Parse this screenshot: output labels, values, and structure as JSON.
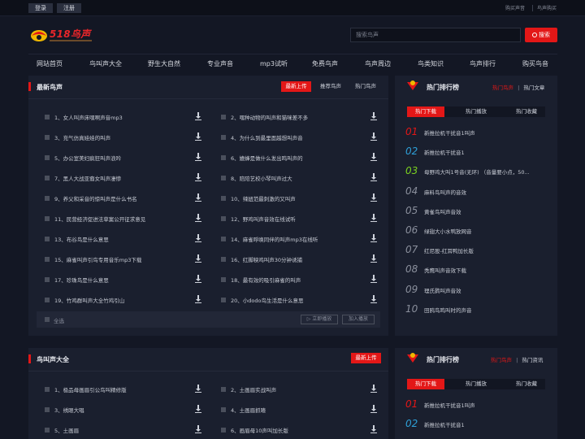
{
  "topbar": {
    "login": "登录",
    "register": "注册",
    "buy_sound": "购买声音",
    "buy_bird": "鸟声购买"
  },
  "logo": {
    "text": "518鸟声"
  },
  "search": {
    "placeholder": "搜索鸟声",
    "button": "搜索"
  },
  "nav": [
    "网站首页",
    "鸟叫声大全",
    "野生大自然",
    "专业声音",
    "mp3试听",
    "免费鸟声",
    "鸟声周边",
    "鸟类知识",
    "鸟声排行",
    "购买鸟音"
  ],
  "latest": {
    "title": "最新鸟声",
    "tabs": [
      "最新上传",
      "推荐鸟声",
      "热门鸟声"
    ],
    "left": [
      "1、女人叫声床嘿啊声音mp3",
      "3、充气仿真娃娃的叫声",
      "5、办公室美妇疯狂叫声浪吟",
      "7、黑人大战亚裔女叫声凄惨",
      "9、养父和采音的惊叫声是什么书名",
      "11、民营经济促进法草案公开征求意见",
      "13、布谷鸟是什么意思",
      "15、麻雀叫声引鸟专用音乐mp3下载",
      "17、珍珠鸟是什么意思",
      "19、竹鸡群叫声大全竹鸡引山"
    ],
    "right": [
      "2、嘿种动物的叫声和猫咪差不多",
      "4、为什么到最里面越想叫声音",
      "6、嬉蜂是做什么发出鸣叫声的",
      "8、陪陪艺校小琴叫声过大",
      "10、辣妞范最刺激的又叫声",
      "12、野鸡叫声音效在线试听",
      "14、麻雀呼唤同伴的叫声mp3在线听",
      "16、红脚秧鸡叫声30分钟诱捕",
      "18、最有效的吸引麻雀的叫声",
      "20、小dodo鸟生活是什么意思"
    ],
    "select_all": "全选",
    "play_btn": "▷ 立即播放",
    "add_btn": "加入播放"
  },
  "rank1": {
    "title": "热门排行榜",
    "link1": "热门鸟声",
    "link2": "热门文章",
    "tabs": [
      "热门下载",
      "热门播放",
      "热门收藏"
    ],
    "items": [
      {
        "num": "01",
        "text": "新推拉机干扰音1叫声"
      },
      {
        "num": "02",
        "text": "新推拉机干扰音1"
      },
      {
        "num": "03",
        "text": "母野鸡大叫1号音(无环) （音量要小点，50..."
      },
      {
        "num": "04",
        "text": "麻料鸟叫声的音效"
      },
      {
        "num": "05",
        "text": "黄雀鸟叫声音效"
      },
      {
        "num": "06",
        "text": "绿翅大小水鸭放网音"
      },
      {
        "num": "07",
        "text": "红尼股-红耳鸭加长版"
      },
      {
        "num": "08",
        "text": "秃鹰叫声音效下载"
      },
      {
        "num": "09",
        "text": "理氏鹨叫声音效"
      },
      {
        "num": "10",
        "text": "田鸦鸟鸣叫时的声音"
      }
    ]
  },
  "all": {
    "title": "鸟叫声大全",
    "tab": "最新上传",
    "left": [
      "1、极品母画眉引公鸟叫精修版",
      "3、绣眼大唱",
      "5、土画眉"
    ],
    "right": [
      "2、土画眉实战叫声",
      "4、土画眉抓喳",
      "6、画眉母10声叫加长版"
    ]
  },
  "rank2": {
    "title": "热门排行榜",
    "link1": "热门鸟声",
    "link2": "热门资讯",
    "tabs": [
      "热门下载",
      "热门播放",
      "热门收藏"
    ],
    "items": [
      {
        "num": "01",
        "text": "新推拉机干扰音1叫声"
      },
      {
        "num": "02",
        "text": "新推拉机干扰音1"
      }
    ]
  },
  "colors": {
    "accent": "#e31717",
    "rank_top": "#e31717",
    "rank_2": "#2ea0d8",
    "rank_3": "#7bd320",
    "rank_other": "#8a8f9c"
  }
}
